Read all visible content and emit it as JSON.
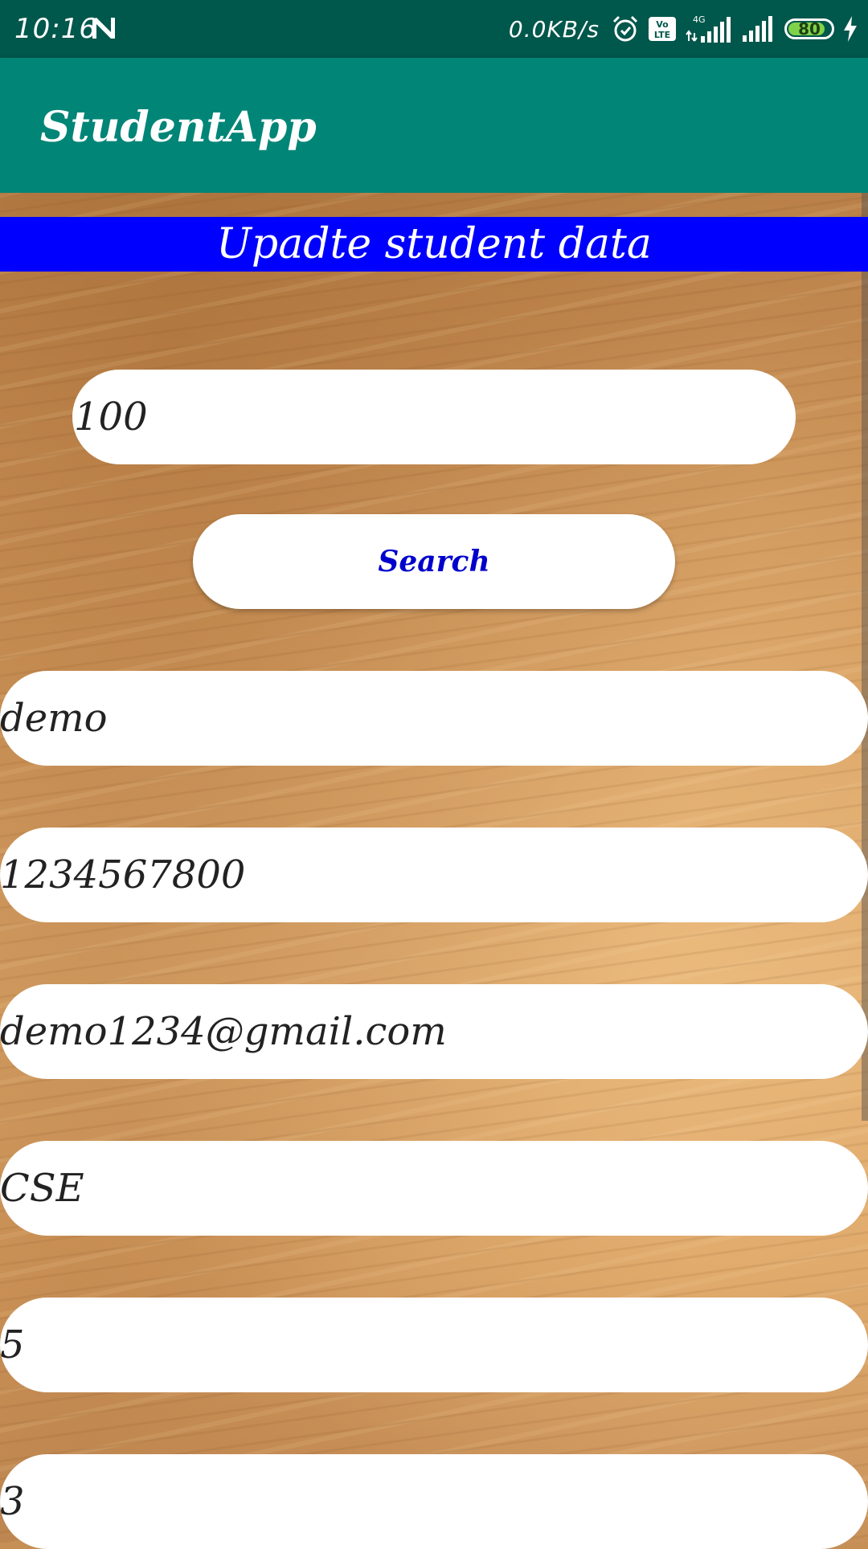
{
  "status_bar": {
    "time": "10:16",
    "net_speed": "0.0KB/s",
    "network_type": "4G",
    "battery_level": "80",
    "icons": [
      "n-notification-icon",
      "alarm-icon",
      "volte-icon",
      "signal-4g-icon",
      "signal-icon",
      "battery-icon",
      "charging-icon"
    ],
    "color": "#00574b"
  },
  "app_bar": {
    "title": "StudentApp",
    "color": "#008577"
  },
  "section_header": {
    "title": "Upadte student data",
    "color": "#0000ff"
  },
  "search": {
    "id_value": "100",
    "button_label": "Search",
    "button_text_color": "#0000cc"
  },
  "fields": [
    {
      "name": "student-name-field",
      "value": "demo"
    },
    {
      "name": "phone-field",
      "value": "1234567800"
    },
    {
      "name": "email-field",
      "value": "demo1234@gmail.com"
    },
    {
      "name": "branch-field",
      "value": "CSE"
    },
    {
      "name": "semester-field",
      "value": "5"
    },
    {
      "name": "year-field",
      "value": "3"
    }
  ]
}
